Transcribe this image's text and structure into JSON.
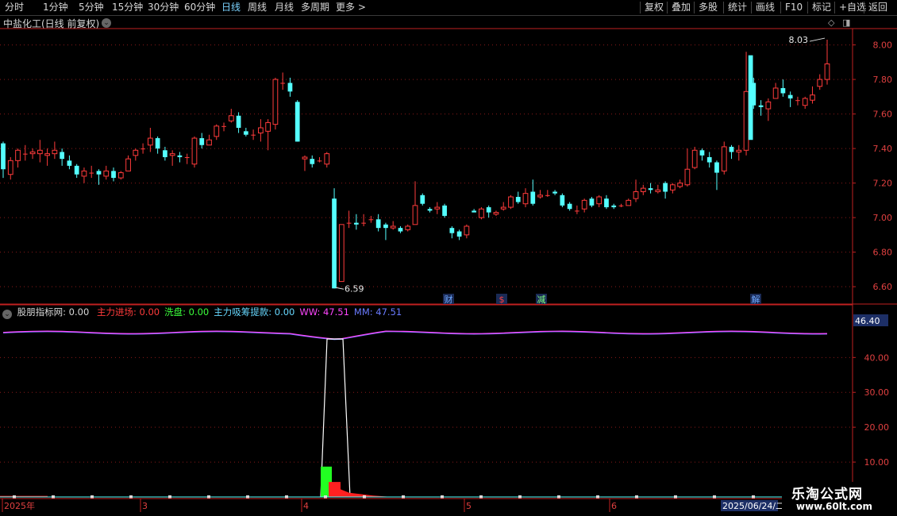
{
  "toolbar": {
    "left_items": [
      {
        "label": "分时",
        "active": false
      },
      {
        "label": "1分钟",
        "active": false
      },
      {
        "label": "5分钟",
        "active": false
      },
      {
        "label": "15分钟",
        "active": false
      },
      {
        "label": "30分钟",
        "active": false
      },
      {
        "label": "60分钟",
        "active": false
      },
      {
        "label": "日线",
        "active": true
      },
      {
        "label": "周线",
        "active": false
      },
      {
        "label": "月线",
        "active": false
      },
      {
        "label": "多周期",
        "active": false
      },
      {
        "label": "更多 >",
        "active": false
      }
    ],
    "right_items": [
      "复权",
      "叠加",
      "多股",
      "统计",
      "画线",
      "F10",
      "标记",
      "+自选",
      "返回"
    ]
  },
  "stock": {
    "title": "中盐化工(日线 前复权)",
    "high_label": "8.03",
    "low_label": "6.59"
  },
  "price_axis": [
    "8.00",
    "7.80",
    "7.60",
    "7.40",
    "7.20",
    "7.00",
    "6.80",
    "6.60"
  ],
  "event_markers": [
    {
      "text": "财",
      "color": "#6fa8ff"
    },
    {
      "text": "$",
      "color": "#ff4040"
    },
    {
      "text": "减",
      "color": "#7fff7f"
    },
    {
      "text": "解",
      "color": "#6fa8ff"
    }
  ],
  "indicator": {
    "name": "股朋指标网",
    "name_value": ": 0.00",
    "fields": [
      {
        "label": "主力进场: 0.00",
        "color": "#ff3b3b"
      },
      {
        "label": "洗盘: 0.00",
        "color": "#3bff3b"
      },
      {
        "label": "主力吸筹提款: 0.00",
        "color": "#67d8ff"
      },
      {
        "label": "WW: 47.51",
        "color": "#ff46ff"
      },
      {
        "label": "MM: 47.51",
        "color": "#6a7bff"
      }
    ],
    "axis": [
      "40.00",
      "30.00",
      "20.00",
      "10.00"
    ],
    "current_value": "46.40"
  },
  "date_axis": {
    "labels": [
      "2025年",
      "3",
      "4",
      "5",
      "6"
    ],
    "current_date": "2025/06/24/二"
  },
  "watermark": {
    "line1": "乐淘公式网",
    "line2": "www.60lt.com"
  },
  "colors": {
    "up": "#ff3b3b",
    "down": "#54ffff",
    "grid": "#8a1a1a",
    "axis_border": "#c02020"
  },
  "chart_data": {
    "type": "candlestick",
    "price_ylim": [
      6.55,
      8.09
    ],
    "candles": [
      [
        7.43,
        7.28,
        7.44,
        7.23
      ],
      [
        7.25,
        7.33,
        7.35,
        7.22
      ],
      [
        7.33,
        7.39,
        7.4,
        7.29
      ],
      [
        7.37,
        7.37,
        7.42,
        7.33
      ],
      [
        7.37,
        7.38,
        7.4,
        7.34
      ],
      [
        7.37,
        7.39,
        7.45,
        7.32
      ],
      [
        7.36,
        7.37,
        7.4,
        7.3
      ],
      [
        7.37,
        7.39,
        7.44,
        7.34
      ],
      [
        7.38,
        7.34,
        7.4,
        7.3
      ],
      [
        7.33,
        7.3,
        7.36,
        7.28
      ],
      [
        7.3,
        7.25,
        7.31,
        7.23
      ],
      [
        7.24,
        7.27,
        7.29,
        7.2
      ],
      [
        7.26,
        7.26,
        7.3,
        7.23
      ],
      [
        7.27,
        7.25,
        7.28,
        7.19
      ],
      [
        7.24,
        7.27,
        7.3,
        7.22
      ],
      [
        7.27,
        7.23,
        7.29,
        7.21
      ],
      [
        7.23,
        7.26,
        7.27,
        7.22
      ],
      [
        7.27,
        7.34,
        7.36,
        7.27
      ],
      [
        7.36,
        7.39,
        7.4,
        7.33
      ],
      [
        7.4,
        7.4,
        7.43,
        7.37
      ],
      [
        7.42,
        7.46,
        7.52,
        7.38
      ],
      [
        7.46,
        7.4,
        7.47,
        7.37
      ],
      [
        7.39,
        7.35,
        7.41,
        7.33
      ],
      [
        7.36,
        7.37,
        7.39,
        7.3
      ],
      [
        7.36,
        7.35,
        7.38,
        7.32
      ],
      [
        7.35,
        7.35,
        7.37,
        7.31
      ],
      [
        7.31,
        7.46,
        7.47,
        7.29
      ],
      [
        7.46,
        7.42,
        7.49,
        7.4
      ],
      [
        7.42,
        7.45,
        7.48,
        7.42
      ],
      [
        7.47,
        7.53,
        7.54,
        7.45
      ],
      [
        7.53,
        7.53,
        7.55,
        7.5
      ],
      [
        7.56,
        7.59,
        7.63,
        7.55
      ],
      [
        7.59,
        7.52,
        7.61,
        7.49
      ],
      [
        7.5,
        7.48,
        7.52,
        7.47
      ],
      [
        7.48,
        7.48,
        7.51,
        7.45
      ],
      [
        7.49,
        7.52,
        7.57,
        7.44
      ],
      [
        7.5,
        7.55,
        7.57,
        7.39
      ],
      [
        7.54,
        7.8,
        7.81,
        7.51
      ],
      [
        7.78,
        7.78,
        7.84,
        7.74
      ],
      [
        7.78,
        7.73,
        7.81,
        7.7
      ],
      [
        7.67,
        7.44,
        7.68,
        7.44
      ],
      [
        7.34,
        7.35,
        7.36,
        7.27
      ],
      [
        7.34,
        7.31,
        7.36,
        7.29
      ],
      [
        7.33,
        7.33,
        7.35,
        7.32
      ],
      [
        7.31,
        7.37,
        7.38,
        7.29
      ],
      [
        7.11,
        6.59,
        7.17,
        6.59
      ],
      [
        6.63,
        6.96,
        6.96,
        6.63
      ],
      [
        6.97,
        6.97,
        7.04,
        6.94
      ],
      [
        6.97,
        6.96,
        7.02,
        6.93
      ],
      [
        6.97,
        6.97,
        7.02,
        6.95
      ],
      [
        6.99,
        6.99,
        7.01,
        6.97
      ],
      [
        6.99,
        6.94,
        7.02,
        6.92
      ],
      [
        6.96,
        6.94,
        6.97,
        6.87
      ],
      [
        6.94,
        6.95,
        6.98,
        6.93
      ],
      [
        6.94,
        6.92,
        6.95,
        6.91
      ],
      [
        6.93,
        6.95,
        6.96,
        6.92
      ],
      [
        6.96,
        7.07,
        7.21,
        6.96
      ],
      [
        7.13,
        7.08,
        7.14,
        7.07
      ],
      [
        7.05,
        7.04,
        7.06,
        7.03
      ],
      [
        7.05,
        7.06,
        7.09,
        7.02
      ],
      [
        7.07,
        7.01,
        7.08,
        7.0
      ],
      [
        6.94,
        6.91,
        6.95,
        6.88
      ],
      [
        6.92,
        6.89,
        6.93,
        6.87
      ],
      [
        6.9,
        6.95,
        6.96,
        6.88
      ],
      [
        7.04,
        7.03,
        7.05,
        7.03
      ],
      [
        7.0,
        7.05,
        7.06,
        6.99
      ],
      [
        7.06,
        7.03,
        7.07,
        7.0
      ],
      [
        7.02,
        7.03,
        7.04,
        7.01
      ],
      [
        7.05,
        7.06,
        7.09,
        7.04
      ],
      [
        7.06,
        7.12,
        7.13,
        7.05
      ],
      [
        7.12,
        7.09,
        7.15,
        7.08
      ],
      [
        7.08,
        7.14,
        7.17,
        7.06
      ],
      [
        7.15,
        7.08,
        7.22,
        7.07
      ],
      [
        7.12,
        7.13,
        7.16,
        7.11
      ],
      [
        7.13,
        7.13,
        7.16,
        7.12
      ],
      [
        7.15,
        7.14,
        7.16,
        7.13
      ],
      [
        7.13,
        7.07,
        7.14,
        7.06
      ],
      [
        7.08,
        7.05,
        7.09,
        7.04
      ],
      [
        7.04,
        7.04,
        7.07,
        7.02
      ],
      [
        7.05,
        7.1,
        7.11,
        7.03
      ],
      [
        7.11,
        7.07,
        7.12,
        7.06
      ],
      [
        7.08,
        7.12,
        7.13,
        7.06
      ],
      [
        7.11,
        7.06,
        7.13,
        7.05
      ],
      [
        7.07,
        7.06,
        7.08,
        7.05
      ],
      [
        7.07,
        7.07,
        7.08,
        7.06
      ],
      [
        7.07,
        7.1,
        7.11,
        7.07
      ],
      [
        7.11,
        7.15,
        7.22,
        7.09
      ],
      [
        7.15,
        7.17,
        7.19,
        7.13
      ],
      [
        7.17,
        7.16,
        7.2,
        7.14
      ],
      [
        7.15,
        7.16,
        7.19,
        7.14
      ],
      [
        7.2,
        7.15,
        7.21,
        7.11
      ],
      [
        7.16,
        7.19,
        7.2,
        7.14
      ],
      [
        7.18,
        7.2,
        7.22,
        7.17
      ],
      [
        7.19,
        7.28,
        7.4,
        7.18
      ],
      [
        7.29,
        7.39,
        7.41,
        7.28
      ],
      [
        7.39,
        7.36,
        7.4,
        7.33
      ],
      [
        7.35,
        7.32,
        7.38,
        7.29
      ],
      [
        7.32,
        7.26,
        7.33,
        7.16
      ],
      [
        7.27,
        7.41,
        7.44,
        7.25
      ],
      [
        7.41,
        7.38,
        7.42,
        7.34
      ],
      [
        7.38,
        7.39,
        7.42,
        7.33
      ],
      [
        7.39,
        7.73,
        7.96,
        7.36
      ],
      [
        7.78,
        7.65,
        7.81,
        7.63
      ],
      [
        7.65,
        7.64,
        7.68,
        7.59
      ],
      [
        7.63,
        7.67,
        7.69,
        7.56
      ],
      [
        7.69,
        7.75,
        7.78,
        7.7
      ],
      [
        7.75,
        7.72,
        7.8,
        7.7
      ],
      [
        7.71,
        7.69,
        7.73,
        7.64
      ],
      [
        7.68,
        7.68,
        7.7,
        7.65
      ],
      [
        7.65,
        7.69,
        7.7,
        7.63
      ],
      [
        7.68,
        7.71,
        7.76,
        7.66
      ],
      [
        7.76,
        7.8,
        7.83,
        7.74
      ],
      [
        7.8,
        7.89,
        8.03,
        7.77
      ]
    ],
    "special_down_bars": [
      [
        7.94,
        7.45
      ]
    ],
    "indicator_ylim": [
      0,
      51
    ],
    "ww_series": "flat near 47 with a dip to ~45.3 around mid-April",
    "spike": {
      "peak": 45.3,
      "base": 0
    },
    "green_bar": 8.7,
    "red_bar": 4.3
  }
}
